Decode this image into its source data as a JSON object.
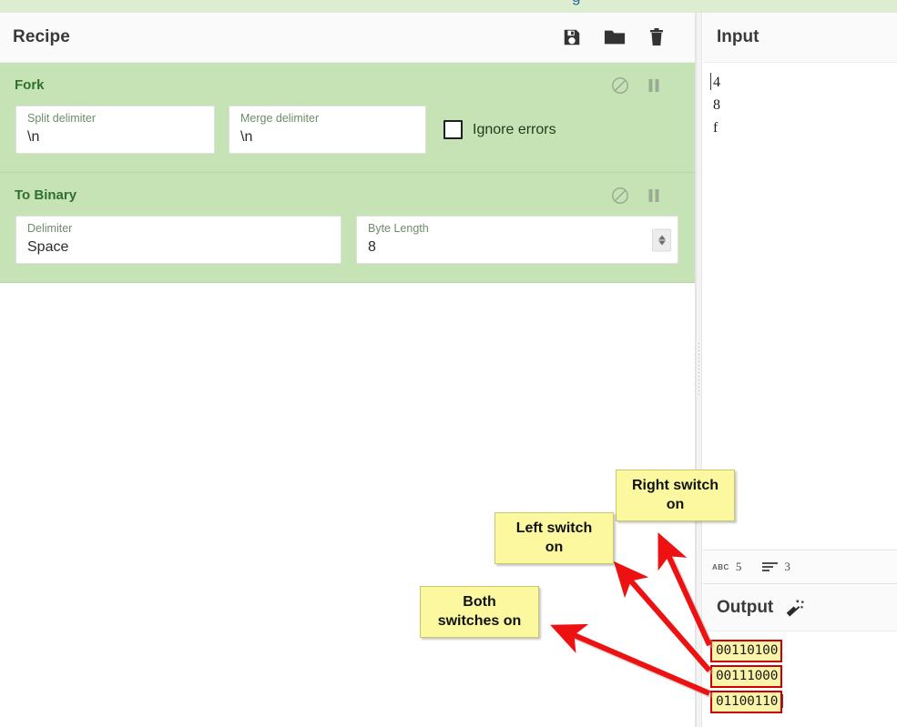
{
  "app": {
    "top_strip_glyph": "g"
  },
  "recipe": {
    "title": "Recipe",
    "icons": [
      {
        "name": "save-icon",
        "label": "Save recipe"
      },
      {
        "name": "folder-icon",
        "label": "Load recipe"
      },
      {
        "name": "trash-icon",
        "label": "Clear recipe"
      }
    ],
    "operations": [
      {
        "name": "Fork",
        "disable_icon": "disable-icon",
        "pause_icon": "pause-icon",
        "args": [
          {
            "label": "Split delimiter",
            "value": "\\n"
          },
          {
            "label": "Merge delimiter",
            "value": "\\n"
          }
        ],
        "checkbox": {
          "label": "Ignore errors",
          "checked": false
        }
      },
      {
        "name": "To Binary",
        "disable_icon": "disable-icon",
        "pause_icon": "pause-icon",
        "args": [
          {
            "label": "Delimiter",
            "value": "Space"
          },
          {
            "label": "Byte Length",
            "value": "8",
            "spinner": true
          }
        ]
      }
    ]
  },
  "input": {
    "title": "Input",
    "lines": [
      "4",
      "8",
      "f"
    ],
    "status": {
      "chars_icon": "abc-icon",
      "chars_label": "ABC",
      "chars": "5",
      "lines_icon": "lines-icon",
      "lines": "3"
    }
  },
  "output": {
    "title": "Output",
    "magic_icon": "magic-wand-icon",
    "values": [
      "00110100",
      "00111000",
      "01100110"
    ]
  },
  "annotations": [
    {
      "id": "right-switch",
      "text": "Right switch\non"
    },
    {
      "id": "left-switch",
      "text": "Left switch\non"
    },
    {
      "id": "both-switches",
      "text": "Both\nswitches on"
    }
  ],
  "colors": {
    "operation_bg": "#c5e3b4",
    "operation_title": "#2f7030",
    "annotation_bg": "#fbf8a0",
    "annotation_border": "#cc0000",
    "arrow": "#ee1111",
    "highlight_bg": "#fbf3a8"
  }
}
